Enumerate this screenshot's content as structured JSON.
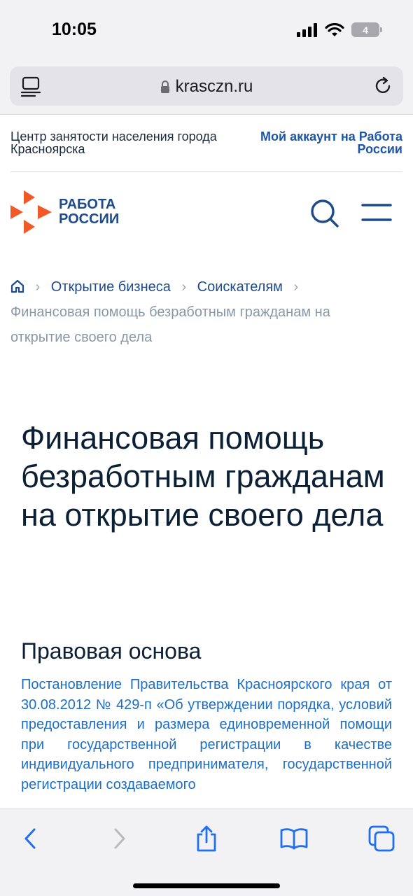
{
  "status_bar": {
    "time": "10:05",
    "battery_level": "4"
  },
  "browser": {
    "url": "krasczn.ru"
  },
  "site_top": {
    "center_name": "Центр занятости населения города Красноярска",
    "account_link": "Мой аккаунт на Работа России"
  },
  "header": {
    "logo_line1": "РАБОТА",
    "logo_line2": "РОССИИ",
    "brand_colors": [
      "#f05a28",
      "#1d4a8f"
    ]
  },
  "breadcrumb": {
    "items": [
      "Открытие бизнеса",
      "Соискателям"
    ],
    "current": "Финансовая помощь безработным гражданам на открытие своего дела"
  },
  "page": {
    "title": "Финансовая помощь безработным гражданам на открытие своего дела",
    "section_title": "Правовая основа",
    "legal_text": "Постановление Правительства Красноярского края от 30.08.2012 № 429-п «Об утверждении порядка, условий предоставления и размера единовременной помощи при государственной регистрации в качестве индивидуального предпринимателя, государственной регистрации создаваемого"
  },
  "toolbar": {
    "icons": [
      "back-icon",
      "forward-icon",
      "share-icon",
      "bookmarks-icon",
      "tabs-icon"
    ]
  }
}
